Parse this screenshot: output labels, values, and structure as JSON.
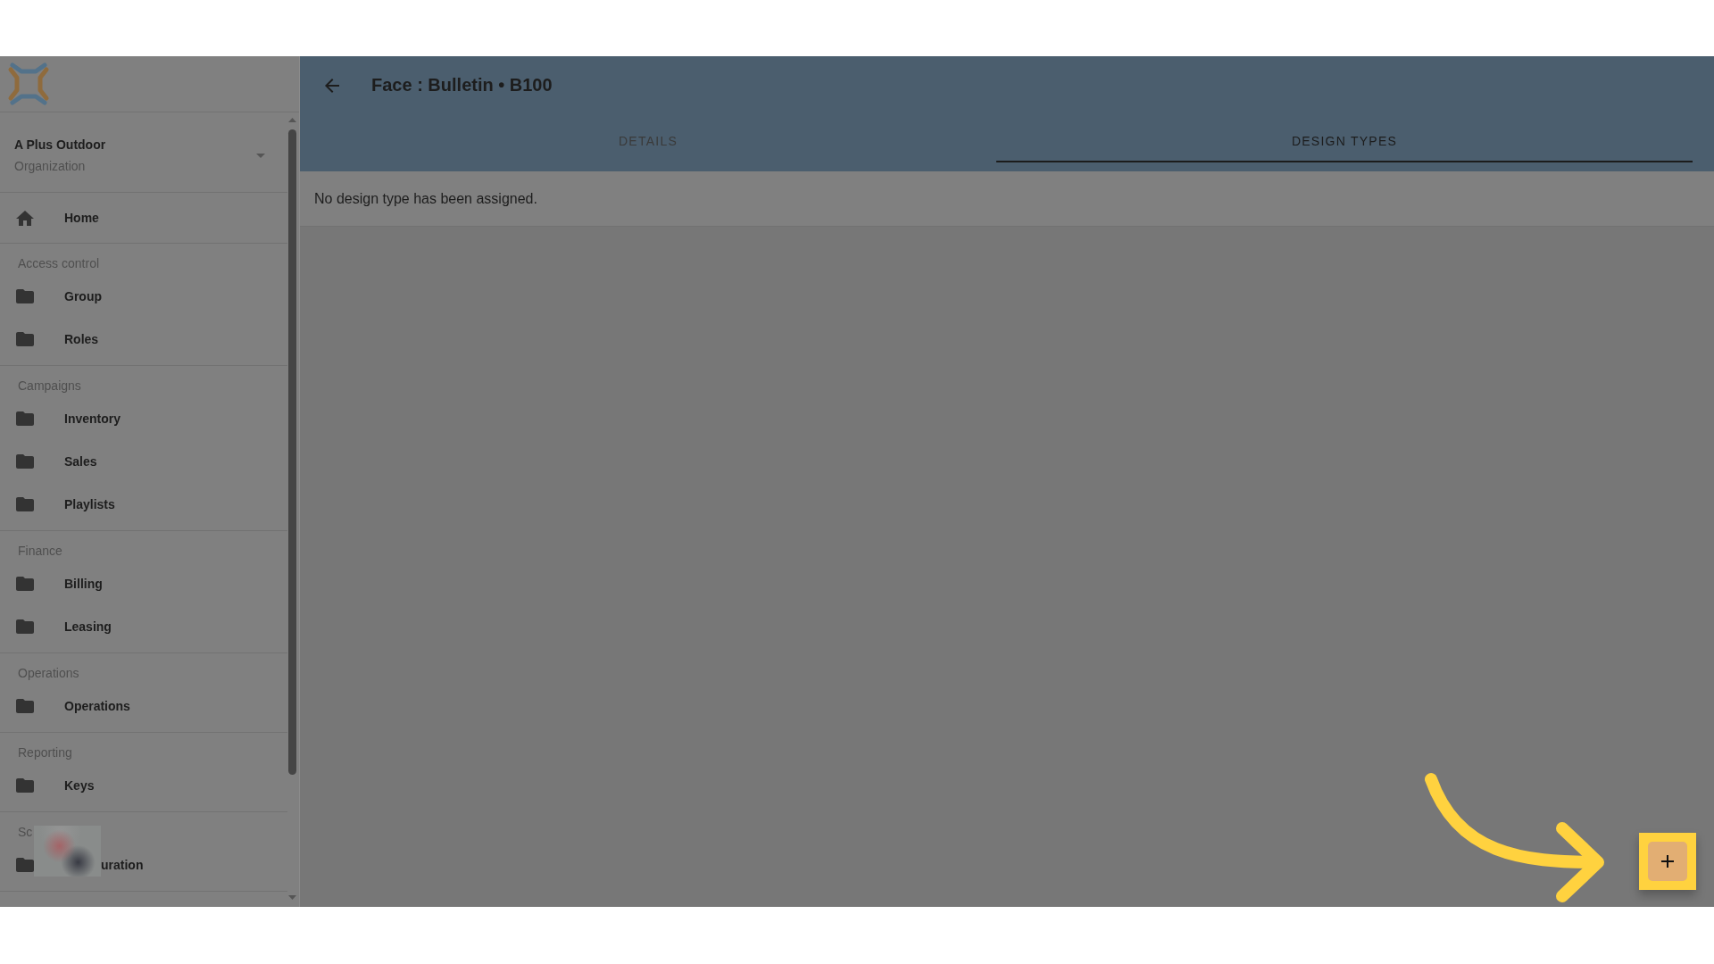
{
  "organization": {
    "name": "A Plus Outdoor",
    "type": "Organization"
  },
  "nav": [
    {
      "items": [
        {
          "kind": "home",
          "label": "Home",
          "selected": false,
          "covered": false
        }
      ]
    },
    {
      "heading": "Access control",
      "items": [
        {
          "kind": "folder",
          "label": "Group",
          "selected": false,
          "covered": false
        },
        {
          "kind": "folder",
          "label": "Roles",
          "selected": false,
          "covered": false
        }
      ]
    },
    {
      "heading": "Campaigns",
      "items": [
        {
          "kind": "folder",
          "label": "Inventory",
          "selected": false,
          "covered": false
        },
        {
          "kind": "folder",
          "label": "Sales",
          "selected": false,
          "covered": false
        },
        {
          "kind": "folder",
          "label": "Playlists",
          "selected": false,
          "covered": false
        }
      ]
    },
    {
      "heading": "Finance",
      "items": [
        {
          "kind": "folder",
          "label": "Billing",
          "selected": false,
          "covered": false
        },
        {
          "kind": "folder",
          "label": "Leasing",
          "selected": false,
          "covered": false
        }
      ]
    },
    {
      "heading": "Operations",
      "items": [
        {
          "kind": "folder",
          "label": "Operations",
          "selected": false,
          "covered": false
        }
      ]
    },
    {
      "heading": "Reporting",
      "items": [
        {
          "kind": "folder",
          "label": "Keys",
          "selected": false,
          "covered": false
        }
      ]
    },
    {
      "heading": "Sc",
      "items": [
        {
          "kind": "folder",
          "label": "uration",
          "selected": false,
          "covered": true
        }
      ]
    }
  ],
  "page": {
    "title": "Face : Bulletin • B100",
    "tabs": [
      {
        "label": "DETAILS",
        "selected": false
      },
      {
        "label": "DESIGN TYPES",
        "selected": true
      }
    ],
    "message": "No design type has been assigned."
  },
  "fab": {
    "highlighted": true
  },
  "tutorial": {
    "dimmed": true,
    "arrow": true
  }
}
